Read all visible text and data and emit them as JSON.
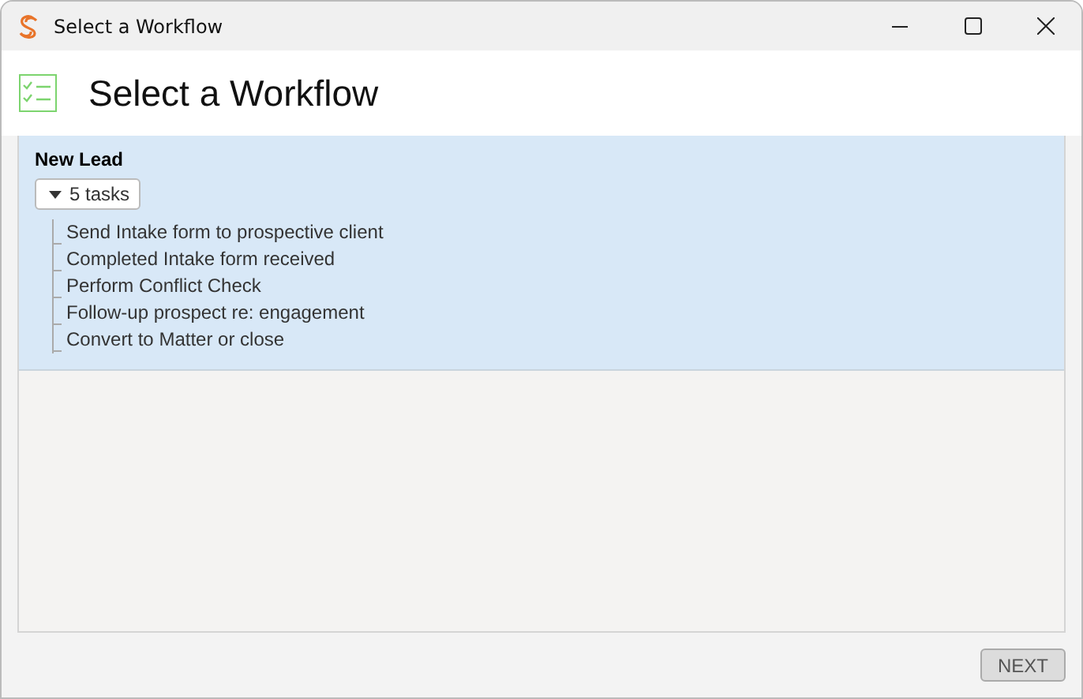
{
  "window": {
    "title": "Select a Workflow"
  },
  "header": {
    "title": "Select a Workflow"
  },
  "workflows": [
    {
      "name": "New Lead",
      "selected": true,
      "expanded": true,
      "task_count": "5 tasks",
      "tasks": [
        "Send Intake form to prospective client",
        "Completed Intake form received",
        "Perform Conflict Check",
        "Follow-up prospect re: engagement",
        "Convert to Matter or close"
      ]
    }
  ],
  "buttons": [
    {
      "label": "NEXT",
      "disabled": true
    }
  ]
}
